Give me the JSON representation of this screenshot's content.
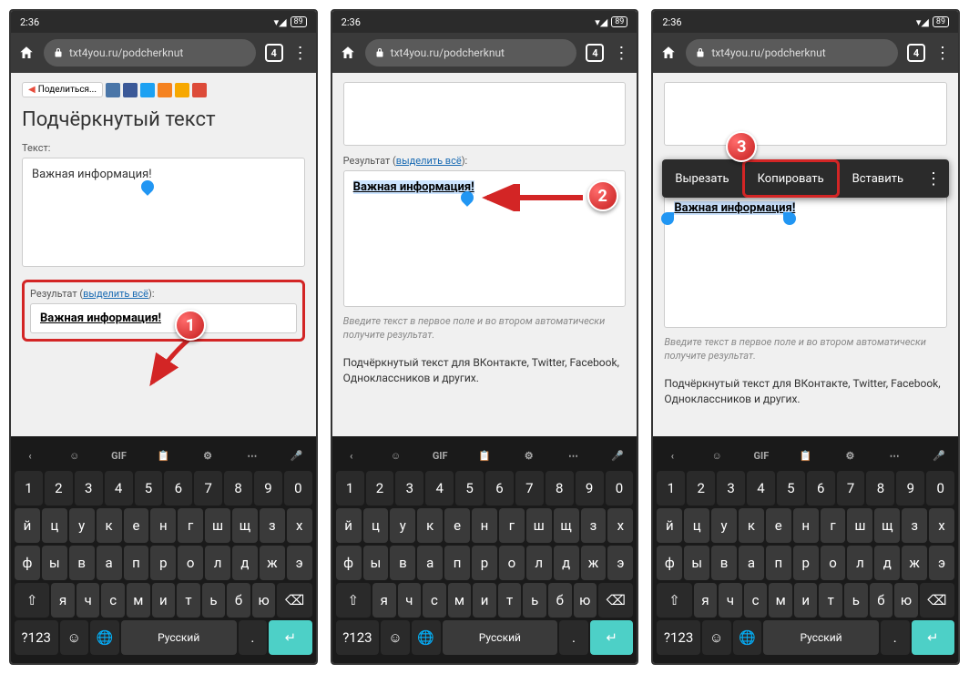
{
  "status": {
    "time": "2:36",
    "battery": "89"
  },
  "nav": {
    "url": "txt4you.ru/podcherknut",
    "tabs": "4"
  },
  "page1": {
    "share": "Поделиться...",
    "title": "Подчёркнутый текст",
    "label_input": "Текст:",
    "input_text": "Важная информация!",
    "label_result_pre": "Результат (",
    "label_result_link": "выделить всё",
    "label_result_post": "):",
    "result_text": "Важная информация!"
  },
  "page2": {
    "label_result_pre": "Результат (",
    "label_result_link": "выделить всё",
    "label_result_post": "):",
    "result_text": "Важная информация!",
    "hint": "Введите текст в первое поле и во втором автоматически получите результат.",
    "desc": "Подчёркнутый текст для ВКонтакте, Twitter, Facebook, Одноклассников и других."
  },
  "page3": {
    "result_text": "Важная информация!",
    "hint": "Введите текст в первое поле и во втором автоматически получите результат.",
    "desc": "Подчёркнутый текст для ВКонтакте, Twitter, Facebook, Одноклассников и других.",
    "menu": {
      "cut": "Вырезать",
      "copy": "Копировать",
      "paste": "Вставить"
    }
  },
  "kb": {
    "nums": [
      "1",
      "2",
      "3",
      "4",
      "5",
      "6",
      "7",
      "8",
      "9",
      "0"
    ],
    "r1": [
      "й",
      "ц",
      "у",
      "к",
      "е",
      "н",
      "г",
      "ш",
      "щ",
      "з",
      "х"
    ],
    "r2": [
      "ф",
      "ы",
      "в",
      "а",
      "п",
      "р",
      "о",
      "л",
      "д",
      "ж",
      "э"
    ],
    "r3": [
      "я",
      "ч",
      "с",
      "м",
      "и",
      "т",
      "ь",
      "б",
      "ю"
    ],
    "sym": "?123",
    "lang": "Русский"
  },
  "badges": {
    "b1": "1",
    "b2": "2",
    "b3": "3"
  }
}
